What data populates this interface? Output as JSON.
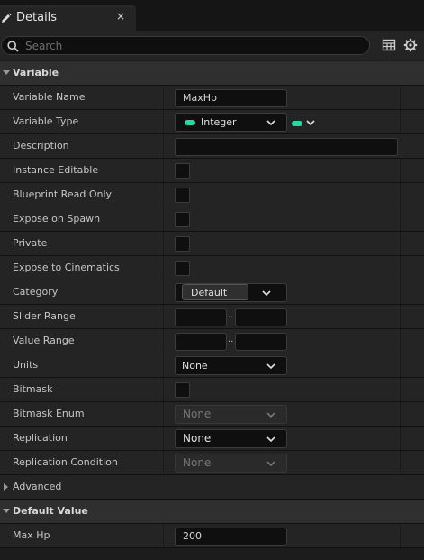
{
  "tab": {
    "title": "Details",
    "close_glyph": "×"
  },
  "search": {
    "placeholder": "Search"
  },
  "icons": {
    "pen": "pencil-icon",
    "search": "search-icon",
    "table": "table-view-icon",
    "settings": "gear-icon"
  },
  "colors": {
    "pin_integer": "#27d9a1"
  },
  "variable_section": {
    "title": "Variable",
    "rows": {
      "variable_name": {
        "label": "Variable Name",
        "value": "MaxHp"
      },
      "variable_type": {
        "label": "Variable Type",
        "value": "Integer"
      },
      "description": {
        "label": "Description",
        "value": ""
      },
      "instance_editable": {
        "label": "Instance Editable"
      },
      "blueprint_read_only": {
        "label": "Blueprint Read Only"
      },
      "expose_on_spawn": {
        "label": "Expose on Spawn"
      },
      "private": {
        "label": "Private"
      },
      "expose_to_cinematics": {
        "label": "Expose to Cinematics"
      },
      "category": {
        "label": "Category",
        "value": "Default"
      },
      "slider_range": {
        "label": "Slider Range",
        "separator": ".."
      },
      "value_range": {
        "label": "Value Range",
        "separator": ".."
      },
      "units": {
        "label": "Units",
        "value": "None"
      },
      "bitmask": {
        "label": "Bitmask"
      },
      "bitmask_enum": {
        "label": "Bitmask Enum",
        "value": "None"
      },
      "replication": {
        "label": "Replication",
        "value": "None"
      },
      "replication_condition": {
        "label": "Replication Condition",
        "value": "None"
      }
    }
  },
  "advanced": {
    "label": "Advanced"
  },
  "default_value_section": {
    "title": "Default Value",
    "max_hp": {
      "label": "Max Hp",
      "value": "200"
    }
  }
}
